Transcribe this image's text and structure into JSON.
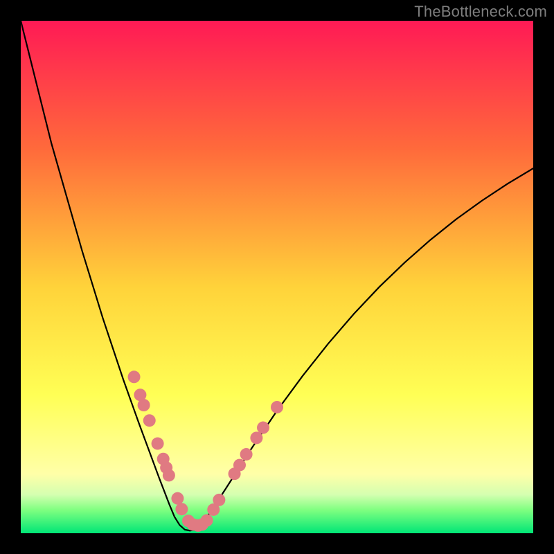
{
  "watermark": "TheBottleneck.com",
  "colors": {
    "bg": "#000000",
    "top": "#ff1a55",
    "mid1": "#ff6a3b",
    "mid2": "#ffd33a",
    "lower": "#ffff55",
    "paleyellow": "#ffffa8",
    "pregreen": "#d4ffb0",
    "green1": "#7eff80",
    "green2": "#00e676",
    "marker": "#e07a82",
    "curve": "#000000"
  },
  "chart_data": {
    "type": "line",
    "title": "",
    "xlabel": "",
    "ylabel": "",
    "xlim": [
      0,
      100
    ],
    "ylim": [
      0,
      100
    ],
    "grid": false,
    "legend": false,
    "series": [
      {
        "name": "bottleneck-curve",
        "x": [
          0,
          2,
          4,
          6,
          8,
          10,
          12,
          14,
          16,
          18,
          20,
          21,
          22,
          23,
          24,
          25,
          26,
          27,
          28,
          29,
          30,
          31,
          32,
          33,
          34,
          35,
          37,
          40,
          45,
          50,
          55,
          60,
          65,
          70,
          75,
          80,
          85,
          90,
          95,
          100
        ],
        "y": [
          100,
          92,
          84,
          76,
          69,
          62,
          55,
          48.5,
          42,
          36,
          30,
          27.2,
          24.4,
          21.6,
          18.9,
          16.2,
          13.5,
          10.8,
          8.2,
          5.6,
          3.2,
          1.6,
          0.7,
          0.5,
          0.7,
          1.6,
          4.1,
          8.7,
          16.5,
          23.9,
          30.7,
          37,
          42.8,
          48.1,
          52.9,
          57.3,
          61.3,
          64.9,
          68.2,
          71.2
        ]
      }
    ],
    "markers": {
      "name": "highlighted-points",
      "color_ref": "marker",
      "points": [
        {
          "x": 22.1,
          "y": 30.5
        },
        {
          "x": 23.3,
          "y": 27.0
        },
        {
          "x": 24.0,
          "y": 25.0
        },
        {
          "x": 25.1,
          "y": 22.0
        },
        {
          "x": 26.7,
          "y": 17.5
        },
        {
          "x": 27.8,
          "y": 14.5
        },
        {
          "x": 28.4,
          "y": 12.8
        },
        {
          "x": 28.9,
          "y": 11.3
        },
        {
          "x": 30.6,
          "y": 6.8
        },
        {
          "x": 31.4,
          "y": 4.7
        },
        {
          "x": 32.7,
          "y": 2.4
        },
        {
          "x": 33.6,
          "y": 1.7
        },
        {
          "x": 34.6,
          "y": 1.5
        },
        {
          "x": 35.4,
          "y": 1.7
        },
        {
          "x": 36.3,
          "y": 2.5
        },
        {
          "x": 37.6,
          "y": 4.6
        },
        {
          "x": 38.7,
          "y": 6.5
        },
        {
          "x": 41.7,
          "y": 11.6
        },
        {
          "x": 42.7,
          "y": 13.3
        },
        {
          "x": 44.0,
          "y": 15.4
        },
        {
          "x": 46.0,
          "y": 18.6
        },
        {
          "x": 47.3,
          "y": 20.6
        },
        {
          "x": 50.0,
          "y": 24.6
        }
      ]
    }
  }
}
